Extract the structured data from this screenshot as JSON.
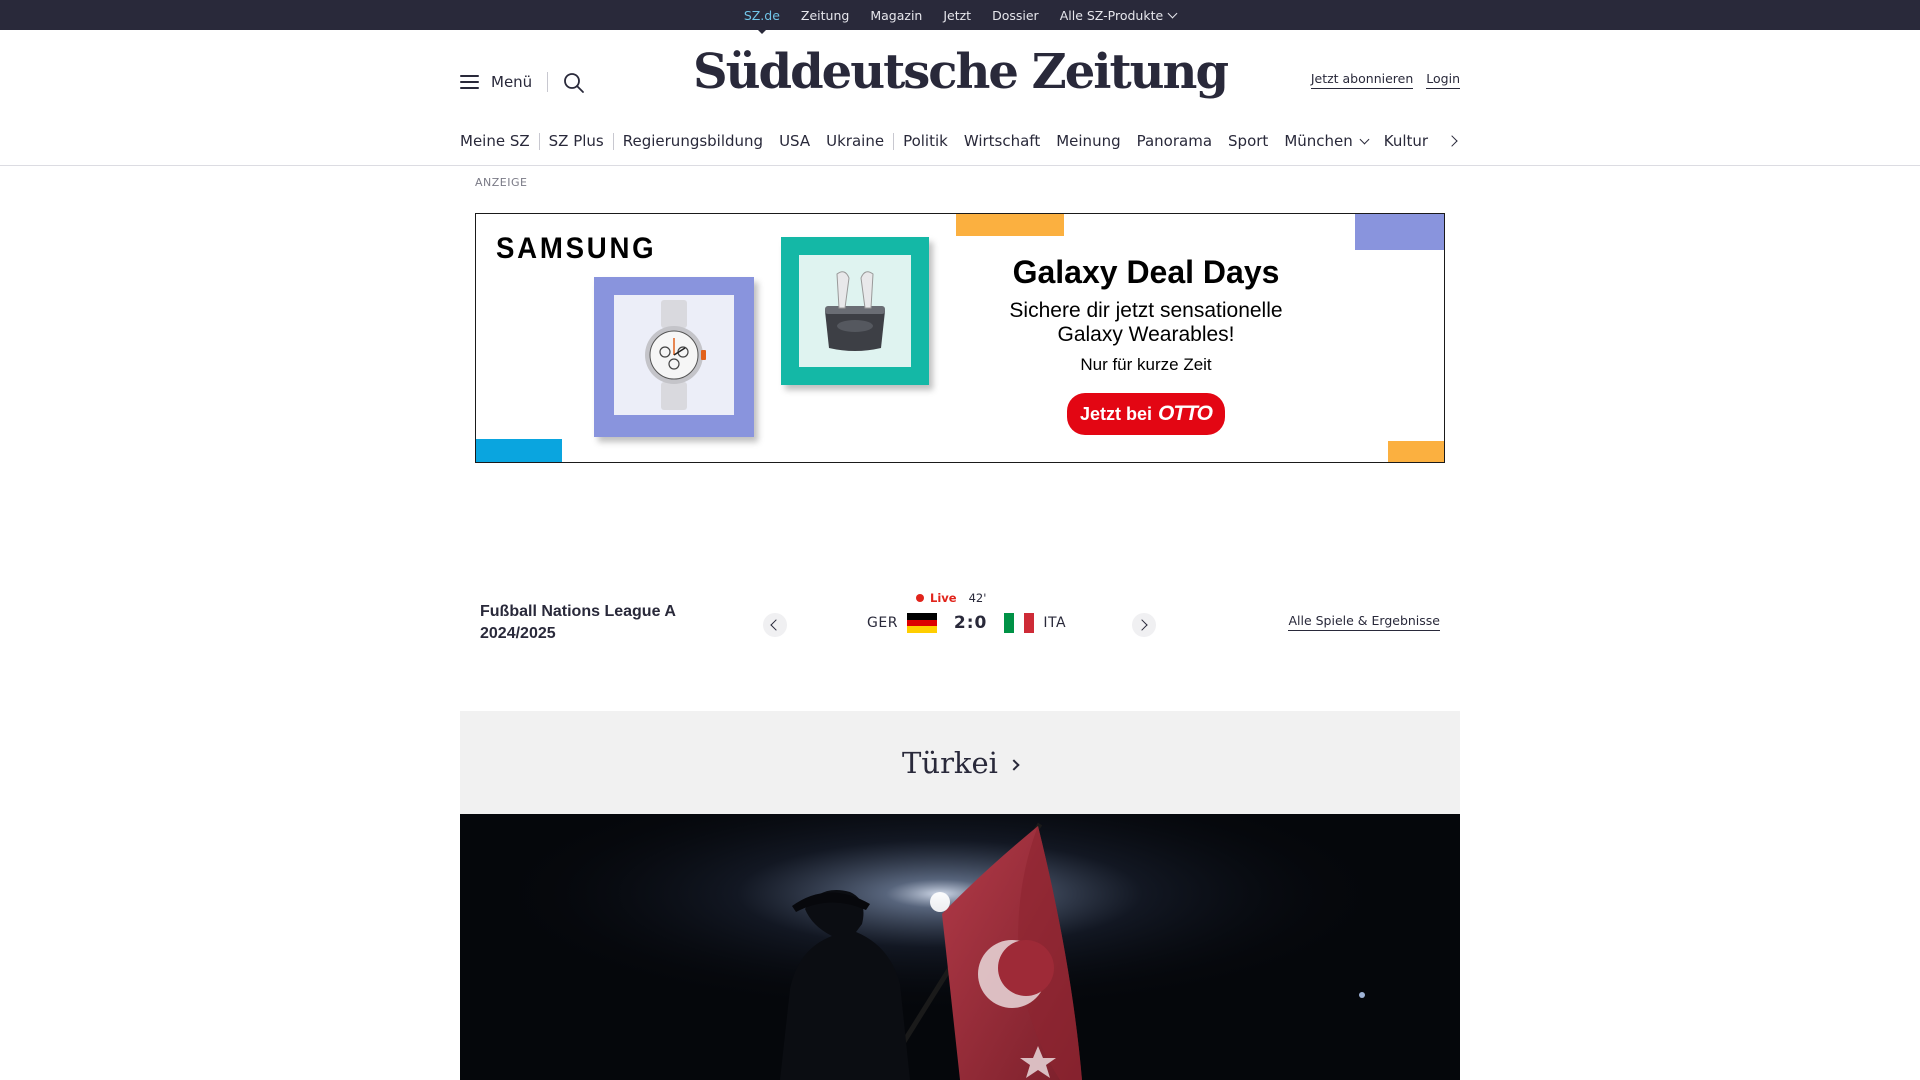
{
  "topbar": {
    "items": [
      "SZ.de",
      "Zeitung",
      "Magazin",
      "Jetzt",
      "Dossier",
      "Alle SZ-Produkte"
    ]
  },
  "header": {
    "menu_label": "Menü",
    "logo_text": "Süddeutsche Zeitung",
    "subscribe_label": "Jetzt abonnieren",
    "login_label": "Login"
  },
  "nav": {
    "items": [
      "Meine SZ",
      "SZ Plus",
      "Regierungsbildung",
      "USA",
      "Ukraine",
      "Politik",
      "Wirtschaft",
      "Meinung",
      "Panorama",
      "Sport",
      "München",
      "Kultur"
    ]
  },
  "ad": {
    "label": "ANZEIGE",
    "brand": "SAMSUNG",
    "title": "Galaxy Deal Days",
    "subtitle_line1": "Sichere dir jetzt sensationelle",
    "subtitle_line2": "Galaxy Wearables!",
    "small": "Nur für kurze Zeit",
    "cta_prefix": "Jetzt bei",
    "cta_brand": "OTTO"
  },
  "ticker": {
    "league_line1": "Fußball Nations League A",
    "league_line2": "2024/2025",
    "live_label": "Live",
    "minute": "42'",
    "home_team": "GER",
    "away_team": "ITA",
    "score": "2:0",
    "all_games_label": "Alle Spiele & Ergebnisse"
  },
  "topic": {
    "title": "Türkei"
  },
  "colors": {
    "dark": "#29293a",
    "active_link": "#71c5e8",
    "live_red": "#e1241b",
    "otto_red": "#e30613",
    "ad_blue": "#8994dd",
    "ad_teal": "#14b8a6",
    "ad_orange": "#fbb040",
    "ad_cyan": "#0aa5df",
    "topic_bg": "#f1f1f1"
  },
  "icons": {
    "menu": "hamburger-icon",
    "search": "search-icon",
    "chevron_down": "chevron-down-icon",
    "chevron_right": "chevron-right-icon",
    "prev": "chevron-left-icon",
    "next": "chevron-right-icon"
  }
}
